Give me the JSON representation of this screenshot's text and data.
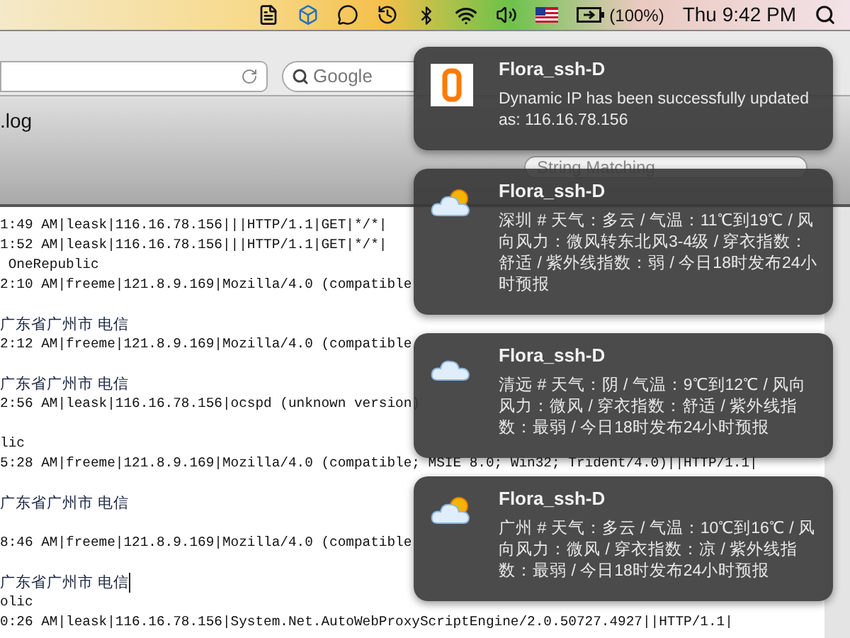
{
  "menubar": {
    "battery_text": "(100%)",
    "clock": "Thu 9:42 PM"
  },
  "browser": {
    "search_placeholder": "Google",
    "tab_title": ".log",
    "filter_placeholder": "String Matching",
    "log_blocks": [
      [
        {
          "text": "1:49 AM|leask|116.16.78.156|||HTTP/1.1|GET|*/*|",
          "kind": "entry",
          "cursor": false
        },
        {
          "text": "1:52 AM|leask|116.16.78.156|||HTTP/1.1|GET|*/*|",
          "kind": "entry",
          "cursor": false
        },
        {
          "text": " OneRepublic",
          "kind": "entry",
          "cursor": false
        },
        {
          "text": "2:10 AM|freeme|121.8.9.169|Mozilla/4.0 (compatible",
          "kind": "entry",
          "cursor": false
        }
      ],
      [
        {
          "text": "广东省广州市 电信",
          "kind": "location",
          "cursor": false
        },
        {
          "text": "2:12 AM|freeme|121.8.9.169|Mozilla/4.0 (compatible",
          "kind": "entry",
          "cursor": false
        }
      ],
      [
        {
          "text": "广东省广州市 电信",
          "kind": "location",
          "cursor": false
        },
        {
          "text": "2:56 AM|leask|116.16.78.156|ocspd (unknown version)",
          "kind": "entry",
          "cursor": false
        }
      ],
      [
        {
          "text": "lic",
          "kind": "entry",
          "cursor": false
        },
        {
          "text": "5:28 AM|freeme|121.8.9.169|Mozilla/4.0 (compatible; MSIE 8.0; Win32; Trident/4.0)||HTTP/1.1|",
          "kind": "entry",
          "cursor": false
        }
      ],
      [
        {
          "text": "广东省广州市 电信",
          "kind": "location",
          "cursor": false
        }
      ],
      [
        {
          "text": "8:46 AM|freeme|121.8.9.169|Mozilla/4.0 (compatible",
          "kind": "entry",
          "cursor": false
        }
      ],
      [
        {
          "text": "广东省广州市 电信",
          "kind": "location",
          "cursor": true
        },
        {
          "text": "olic",
          "kind": "entry",
          "cursor": false
        },
        {
          "text": "0:26 AM|leask|116.16.78.156|System.Net.AutoWebProxyScriptEngine/2.0.50727.4927||HTTP/1.1|",
          "kind": "entry",
          "cursor": false
        }
      ]
    ]
  },
  "notifications": [
    {
      "kind": "logo",
      "title": "Flora_ssh-D",
      "message": "Dynamic IP has been successfully updated as: 116.16.78.156"
    },
    {
      "kind": "sun_cloud",
      "title": "Flora_ssh-D",
      "message": "深圳 # 天气：多云 / 气温：11℃到19℃ / 风向风力：微风转东北风3-4级 / 穿衣指数：舒适 / 紫外线指数：弱 / 今日18时发布24小时预报"
    },
    {
      "kind": "cloud",
      "title": "Flora_ssh-D",
      "message": "清远 # 天气：阴 / 气温：9℃到12℃ / 风向风力：微风 / 穿衣指数：舒适 / 紫外线指数：最弱 / 今日18时发布24小时预报"
    },
    {
      "kind": "sun_cloud",
      "title": "Flora_ssh-D",
      "message": "广州 # 天气：多云 / 气温：10℃到16℃ / 风向风力：微风 / 穿衣指数：凉 / 紫外线指数：最弱 / 今日18时发布24小时预报"
    }
  ]
}
